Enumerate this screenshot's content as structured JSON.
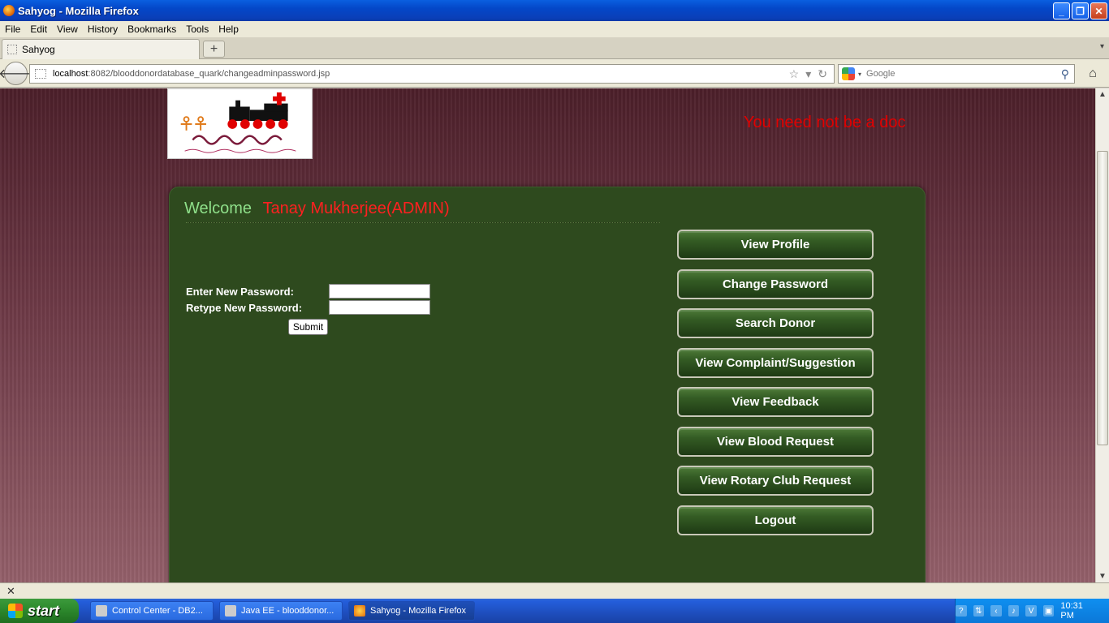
{
  "window": {
    "title": "Sahyog - Mozilla Firefox"
  },
  "menubar": [
    "File",
    "Edit",
    "View",
    "History",
    "Bookmarks",
    "Tools",
    "Help"
  ],
  "tab": {
    "label": "Sahyog"
  },
  "navbar": {
    "url_host": "localhost",
    "url_path": ":8082/blooddonordatabase_quark/changeadminpassword.jsp",
    "search_placeholder": "Google"
  },
  "page": {
    "tagline": "You need not be a doc",
    "welcome_label": "Welcome",
    "admin_name": "Tanay Mukherjee(ADMIN)",
    "form": {
      "new_password_label": "Enter New Password:",
      "retype_password_label": "Retype New Password:",
      "submit_label": "Submit"
    },
    "menu": [
      "View Profile",
      "Change Password",
      "Search Donor",
      "View Complaint/Suggestion",
      "View Feedback",
      "View Blood Request",
      "View Rotary Club Request",
      "Logout"
    ]
  },
  "taskbar": {
    "start_label": "start",
    "tasks": [
      "Control Center - DB2...",
      "Java EE - blooddonor...",
      "Sahyog - Mozilla Firefox"
    ],
    "clock": "10:31 PM"
  },
  "colors": {
    "panel": "#2e4a1e",
    "accent_red": "#ff2020",
    "welcome_green": "#8fe08a"
  }
}
